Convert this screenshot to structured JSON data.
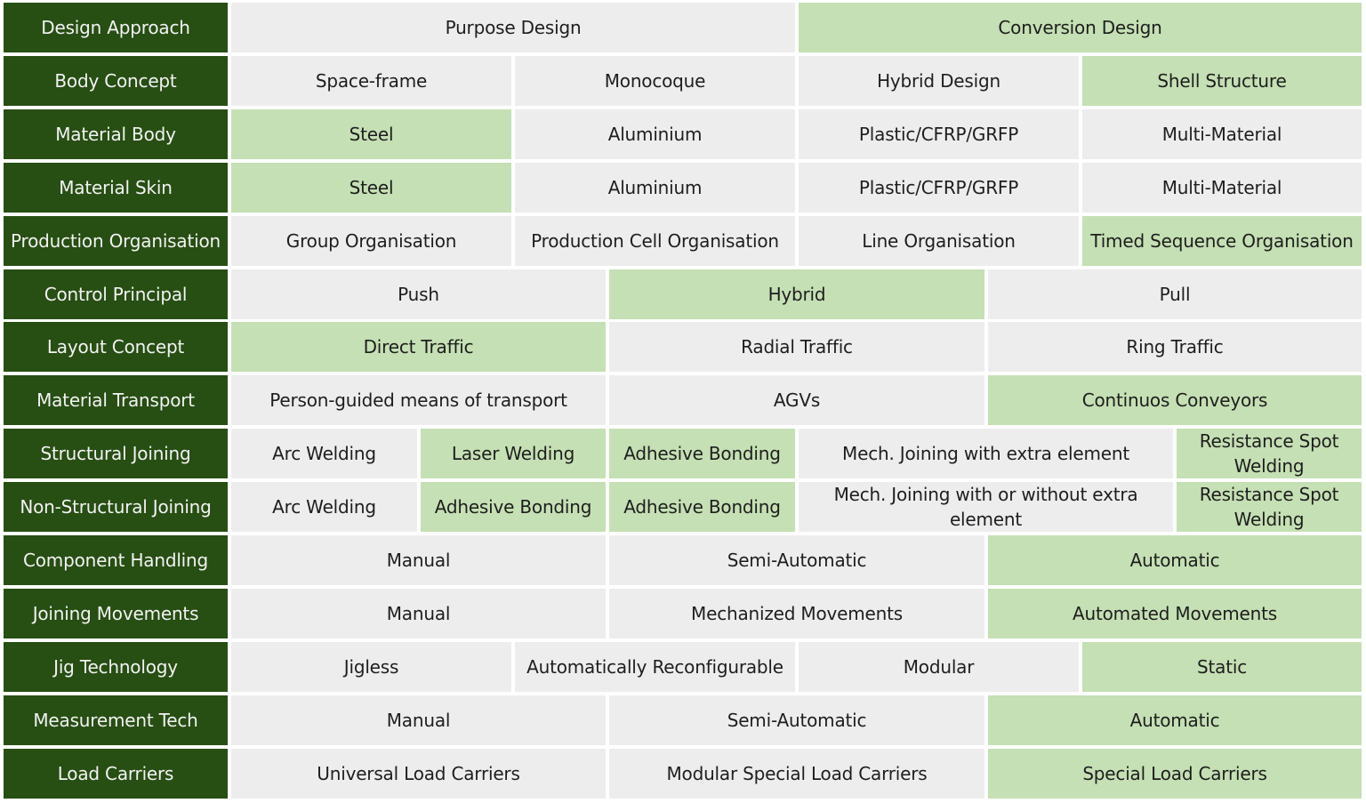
{
  "colors": {
    "header_bg": "#274e13",
    "header_text": "#f2f2f2",
    "cell_bg": "#ededed",
    "highlight_bg": "#c5e0b4",
    "text": "#1e1e1e"
  },
  "rows": [
    {
      "label": "Design Approach",
      "layout": "2",
      "cells": [
        {
          "text": "Purpose Design",
          "selected": false
        },
        {
          "text": "Conversion Design",
          "selected": true
        }
      ]
    },
    {
      "label": "Body Concept",
      "layout": "4",
      "cells": [
        {
          "text": "Space-frame",
          "selected": false
        },
        {
          "text": "Monocoque",
          "selected": false
        },
        {
          "text": "Hybrid Design",
          "selected": false
        },
        {
          "text": "Shell Structure",
          "selected": true
        }
      ]
    },
    {
      "label": "Material Body",
      "layout": "4",
      "cells": [
        {
          "text": "Steel",
          "selected": true
        },
        {
          "text": "Aluminium",
          "selected": false
        },
        {
          "text": "Plastic/CFRP/GRFP",
          "selected": false
        },
        {
          "text": "Multi-Material",
          "selected": false
        }
      ]
    },
    {
      "label": "Material Skin",
      "layout": "4",
      "cells": [
        {
          "text": "Steel",
          "selected": true
        },
        {
          "text": "Aluminium",
          "selected": false
        },
        {
          "text": "Plastic/CFRP/GRFP",
          "selected": false
        },
        {
          "text": "Multi-Material",
          "selected": false
        }
      ]
    },
    {
      "label": "Production Organisation",
      "layout": "4",
      "cells": [
        {
          "text": "Group Organisation",
          "selected": false
        },
        {
          "text": "Production Cell Organisation",
          "selected": false
        },
        {
          "text": "Line Organisation",
          "selected": false
        },
        {
          "text": "Timed Sequence Organisation",
          "selected": true
        }
      ]
    },
    {
      "label": "Control Principal",
      "layout": "3",
      "cells": [
        {
          "text": "Push",
          "selected": false
        },
        {
          "text": "Hybrid",
          "selected": true
        },
        {
          "text": "Pull",
          "selected": false
        }
      ]
    },
    {
      "label": "Layout Concept",
      "layout": "3",
      "cells": [
        {
          "text": "Direct Traffic",
          "selected": true
        },
        {
          "text": "Radial Traffic",
          "selected": false
        },
        {
          "text": "Ring Traffic",
          "selected": false
        }
      ]
    },
    {
      "label": "Material Transport",
      "layout": "3",
      "cells": [
        {
          "text": "Person-guided means of transport",
          "selected": false
        },
        {
          "text": "AGVs",
          "selected": false
        },
        {
          "text": "Continuos Conveyors",
          "selected": true
        }
      ]
    },
    {
      "label": "Structural Joining",
      "layout": "5",
      "cells": [
        {
          "text": "Arc Welding",
          "selected": false
        },
        {
          "text": "Laser Welding",
          "selected": true
        },
        {
          "text": "Adhesive Bonding",
          "selected": true
        },
        {
          "text": "Mech. Joining with extra element",
          "selected": false
        },
        {
          "text": "Resistance Spot Welding",
          "selected": true
        }
      ]
    },
    {
      "label": "Non-Structural Joining",
      "layout": "5",
      "cells": [
        {
          "text": "Arc Welding",
          "selected": false
        },
        {
          "text": "Adhesive Bonding",
          "selected": true
        },
        {
          "text": "Adhesive Bonding",
          "selected": true
        },
        {
          "text": "Mech. Joining with or without extra element",
          "selected": false
        },
        {
          "text": "Resistance Spot Welding",
          "selected": true
        }
      ]
    },
    {
      "label": "Component Handling",
      "layout": "3",
      "cells": [
        {
          "text": "Manual",
          "selected": false
        },
        {
          "text": "Semi-Automatic",
          "selected": false
        },
        {
          "text": "Automatic",
          "selected": true
        }
      ]
    },
    {
      "label": "Joining Movements",
      "layout": "3",
      "cells": [
        {
          "text": "Manual",
          "selected": false
        },
        {
          "text": "Mechanized Movements",
          "selected": false
        },
        {
          "text": "Automated Movements",
          "selected": true
        }
      ]
    },
    {
      "label": "Jig Technology",
      "layout": "4",
      "cells": [
        {
          "text": "Jigless",
          "selected": false
        },
        {
          "text": "Automatically Reconfigurable",
          "selected": false
        },
        {
          "text": "Modular",
          "selected": false
        },
        {
          "text": "Static",
          "selected": true
        }
      ]
    },
    {
      "label": "Measurement Tech",
      "layout": "3",
      "cells": [
        {
          "text": "Manual",
          "selected": false
        },
        {
          "text": "Semi-Automatic",
          "selected": false
        },
        {
          "text": "Automatic",
          "selected": true
        }
      ]
    },
    {
      "label": "Load Carriers",
      "layout": "3",
      "cells": [
        {
          "text": "Universal Load Carriers",
          "selected": false
        },
        {
          "text": "Modular Special Load Carriers",
          "selected": false
        },
        {
          "text": "Special Load Carriers",
          "selected": true
        }
      ]
    }
  ]
}
